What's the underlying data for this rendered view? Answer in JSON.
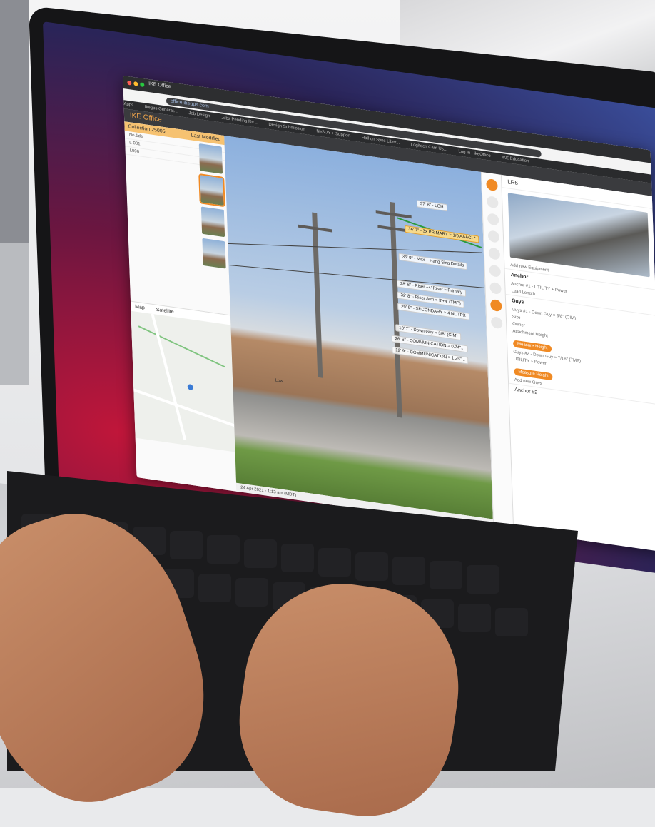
{
  "browser": {
    "tab_title": "IKE Office",
    "url": "office.ikegps.com",
    "bookmarks": [
      "Apps",
      "Ikegps Generat...",
      "Job Design",
      "Jobs Pending Re...",
      "Design Submission",
      "NeSUY + Support",
      "Hall on Sync Liber...",
      "Logitech Cam Us...",
      "Log In - ikeOffice",
      "IKE Education"
    ]
  },
  "app": {
    "title": "IKE Office",
    "collection_header": "Collection 25005",
    "last_modified": "Last Modified",
    "collection_rows": [
      "No.1de",
      "L-001",
      "L006"
    ],
    "map_tabs": [
      "Map",
      "Satellite"
    ],
    "photo_footer": "24 Apr 2021 - 1:13 am (MDT)",
    "photo_caption": "Low"
  },
  "measurements": [
    {
      "text": "37' 8\" - LOH"
    },
    {
      "text": "36' 7\" - 3x PRIMARY = 1/0 AAAC) *",
      "highlight": true
    },
    {
      "text": "35' 9\" - Max + Hang Sing Details"
    },
    {
      "text": "28' 8\" - Riser +4' Riser = Primary"
    },
    {
      "text": "32' 8\" - Riser Arm = 3'+4' (TMP)"
    },
    {
      "text": "29' 9\" - SECONDARY = 4 NL TPX"
    },
    {
      "text": "18' 7\" - Down Guy = 3/8\" (CIM)"
    },
    {
      "text": "26' 6\" - COMMUNICATION = 0.74\"..."
    },
    {
      "text": "12' 9\" - COMMUNICATION = 1.25\"..."
    }
  ],
  "right_panel": {
    "title": "LR6",
    "add_equipment": "Add new Equipment",
    "anchor_label": "Anchor",
    "anchor_item": "Anchor #1 - UTILITY + Power",
    "lead_length": "Lead Length",
    "guys_label": "Guys",
    "guy1": "Guys #1 - Down Guy = 3/8\" (CIM)",
    "guy2": "Guys #2 - Down Guy = 7/16\" (TMB)",
    "size_label": "Size",
    "owner_label": "Owner",
    "attachment_height": "Attachment Height",
    "measure_height": "Measure Height",
    "add_new_guy": "Add new Guys",
    "anchor2": "Anchor #2",
    "owner_value": "UTILITY + Power"
  },
  "colors": {
    "accent": "#f08a24",
    "highlight_label": "#f7d98a",
    "screen_bg": "#6b1640"
  }
}
